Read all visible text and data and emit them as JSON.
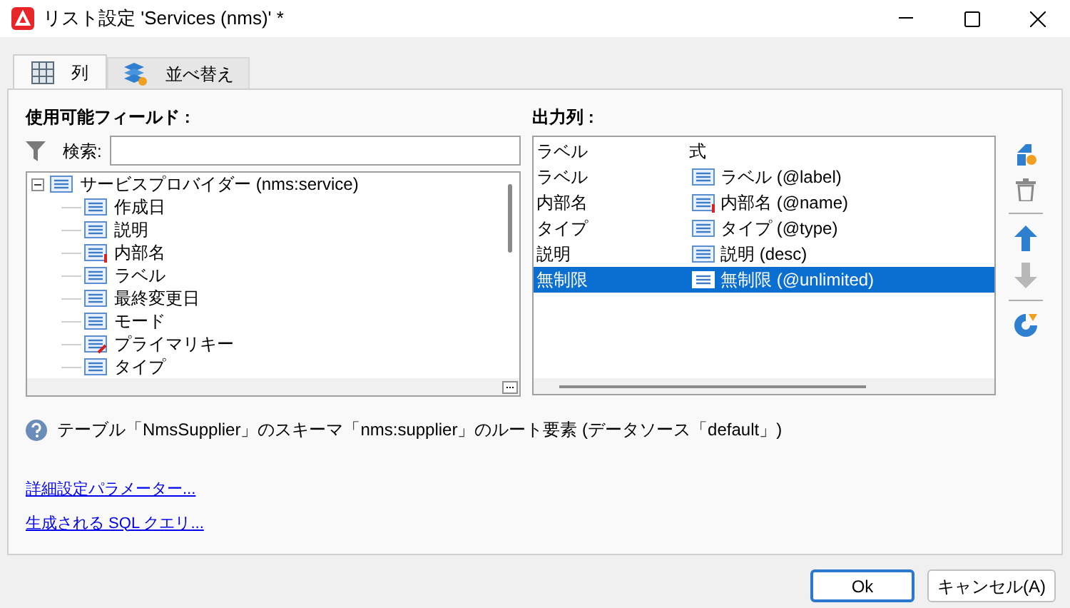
{
  "window": {
    "title": "リスト設定 'Services (nms)' *"
  },
  "tabs": [
    {
      "label": "列",
      "selected": true,
      "kind": "columns"
    },
    {
      "label": "並べ替え",
      "selected": false,
      "kind": "sort"
    }
  ],
  "available_fields": {
    "label": "使用可能フィールド :",
    "search": {
      "label": "検索:"
    },
    "tree": [
      {
        "label": "サービスプロバイダー (nms:service)",
        "kind": "field",
        "expanded": true,
        "children": [
          {
            "label": "作成日",
            "kind": "field"
          },
          {
            "label": "説明",
            "kind": "field"
          },
          {
            "label": "内部名",
            "kind": "mandatory"
          },
          {
            "label": "ラベル",
            "kind": "field"
          },
          {
            "label": "最終変更日",
            "kind": "field"
          },
          {
            "label": "モード",
            "kind": "field"
          },
          {
            "label": "プライマリキー",
            "kind": "key"
          },
          {
            "label": "タイプ",
            "kind": "field"
          }
        ]
      }
    ]
  },
  "output_columns": {
    "label": "出力列 :",
    "columns": [
      "ラベル",
      "式"
    ],
    "rows": [
      {
        "label": "ラベル",
        "expression": "ラベル (@label)",
        "kind": "field",
        "selected": false
      },
      {
        "label": "内部名",
        "expression": "内部名 (@name)",
        "kind": "mandatory",
        "selected": false
      },
      {
        "label": "タイプ",
        "expression": "タイプ (@type)",
        "kind": "field",
        "selected": false
      },
      {
        "label": "説明",
        "expression": "説明 (desc)",
        "kind": "field",
        "selected": false
      },
      {
        "label": "無制限",
        "expression": "無制限 (@unlimited)",
        "kind": "field",
        "selected": true
      }
    ]
  },
  "info": "テーブル「NmsSupplier」のスキーマ「nms:supplier」のルート要素 (データソース「default」)",
  "links": [
    "詳細設定パラメーター...",
    "生成される SQL クエリ..."
  ],
  "buttons": [
    {
      "label": "Ok",
      "kind": "primary"
    },
    {
      "label": "キャンセル(A)",
      "kind": "secondary"
    }
  ]
}
